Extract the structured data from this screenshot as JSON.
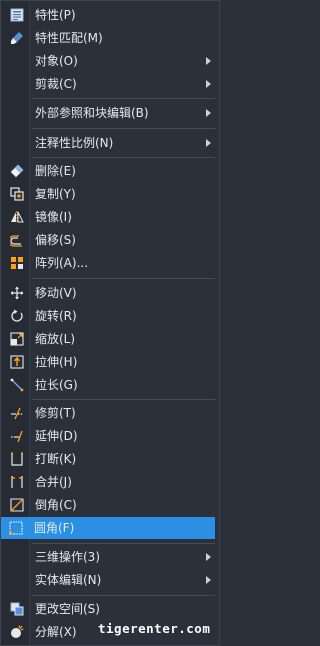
{
  "menu": {
    "items": [
      {
        "label": "特性(P)",
        "icon": "properties-icon"
      },
      {
        "label": "特性匹配(M)",
        "icon": "match-properties-brush-icon"
      },
      {
        "label": "对象(O)",
        "submenu": true
      },
      {
        "label": "剪裁(C)",
        "submenu": true
      },
      {
        "label": "外部参照和块编辑(B)",
        "submenu": true
      },
      {
        "label": "注释性比例(N)",
        "submenu": true
      },
      {
        "label": "删除(E)",
        "icon": "eraser-icon"
      },
      {
        "label": "复制(Y)",
        "icon": "copy-icon"
      },
      {
        "label": "镜像(I)",
        "icon": "mirror-icon"
      },
      {
        "label": "偏移(S)",
        "icon": "offset-icon"
      },
      {
        "label": "阵列(A)...",
        "icon": "array-icon"
      },
      {
        "label": "移动(V)",
        "icon": "move-icon"
      },
      {
        "label": "旋转(R)",
        "icon": "rotate-icon"
      },
      {
        "label": "缩放(L)",
        "icon": "scale-icon"
      },
      {
        "label": "拉伸(H)",
        "icon": "stretch-icon"
      },
      {
        "label": "拉长(G)",
        "icon": "lengthen-icon"
      },
      {
        "label": "修剪(T)",
        "icon": "trim-icon"
      },
      {
        "label": "延伸(D)",
        "icon": "extend-icon"
      },
      {
        "label": "打断(K)",
        "icon": "break-icon"
      },
      {
        "label": "合并(J)",
        "icon": "join-icon"
      },
      {
        "label": "倒角(C)",
        "icon": "chamfer-icon"
      },
      {
        "label": "圆角(F)",
        "icon": "fillet-icon",
        "active": true
      },
      {
        "label": "三维操作(3)",
        "submenu": true
      },
      {
        "label": "实体编辑(N)",
        "submenu": true
      },
      {
        "label": "更改空间(S)",
        "icon": "change-space-icon"
      },
      {
        "label": "分解(X)",
        "icon": "explode-icon"
      }
    ]
  },
  "watermark": "tigerenter.com",
  "colors": {
    "background": "#2b313b",
    "highlight": "#2b8fe3",
    "text": "#e6e8eb"
  }
}
